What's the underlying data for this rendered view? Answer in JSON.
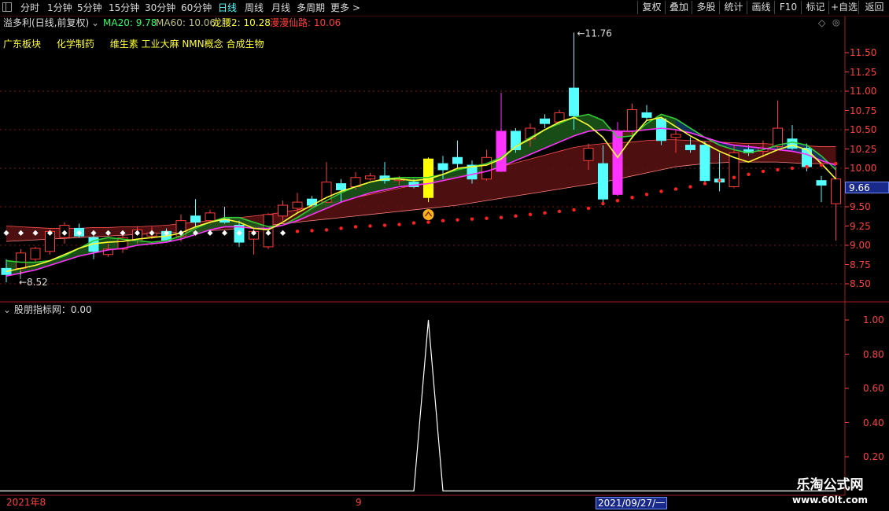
{
  "toolbar": {
    "periods": [
      "分时",
      "1分钟",
      "5分钟",
      "15分钟",
      "30分钟",
      "60分钟",
      "日线",
      "周线",
      "月线",
      "多周期",
      "更多 >"
    ],
    "active_period": "日线",
    "right_buttons": [
      "复权",
      "叠加",
      "多股",
      "统计",
      "画线",
      "F10",
      "标记",
      "+自选",
      "返回"
    ]
  },
  "info_bar": {
    "stock_name": "溢多利(日线,前复权)",
    "ma20": "MA20: 9.78",
    "ma60": "MA60: 10.06",
    "longyao": "龙腰2: 10.28",
    "xianlu": "漫漫仙路: 10.06"
  },
  "concepts": [
    "广东板块",
    "化学制药",
    "维生素 工业大麻 NMN概念 合成生物"
  ],
  "price_axis": {
    "ticks": [
      "11.50",
      "11.25",
      "11.00",
      "10.75",
      "10.50",
      "10.25",
      "10.00",
      "9.75",
      "9.50",
      "9.25",
      "9.00",
      "8.75",
      "8.50"
    ],
    "current_price": "9.66",
    "high_label": "11.76",
    "low_label": "8.52"
  },
  "indicator": {
    "title": "股朋指标网：0.00",
    "ticks": [
      "1.00",
      "0.80",
      "0.60",
      "0.40",
      "0.20"
    ]
  },
  "date_bar": {
    "left": "2021年8",
    "mid": "9",
    "selected": "2021/09/27/一"
  },
  "watermark": {
    "title": "乐淘公式网",
    "url": "www.60lt.com"
  },
  "colors": {
    "up": "#ff3b3b",
    "down": "#55ffff",
    "ma_yellow": "#ffff33",
    "ma_magenta": "#ff33ff",
    "ma_green": "#33cc33",
    "axis": "#ff4040"
  },
  "chart_data": {
    "type": "candlestick",
    "dates_shown": [
      "2021年8",
      "9",
      "2021/09/27/一"
    ],
    "ohlc": [
      {
        "o": 8.7,
        "h": 8.82,
        "l": 8.52,
        "c": 8.62,
        "type": "down"
      },
      {
        "o": 8.7,
        "h": 8.95,
        "l": 8.62,
        "c": 8.9,
        "type": "up"
      },
      {
        "o": 8.82,
        "h": 8.98,
        "l": 8.78,
        "c": 8.96,
        "type": "up"
      },
      {
        "o": 8.92,
        "h": 9.2,
        "l": 8.88,
        "c": 9.18,
        "type": "up"
      },
      {
        "o": 9.1,
        "h": 9.3,
        "l": 9.02,
        "c": 9.26,
        "type": "up"
      },
      {
        "o": 9.22,
        "h": 9.28,
        "l": 9.1,
        "c": 9.12,
        "type": "down"
      },
      {
        "o": 9.1,
        "h": 9.18,
        "l": 8.82,
        "c": 8.92,
        "type": "down"
      },
      {
        "o": 8.88,
        "h": 9.02,
        "l": 8.85,
        "c": 8.95,
        "type": "up"
      },
      {
        "o": 8.95,
        "h": 9.16,
        "l": 8.9,
        "c": 9.1,
        "type": "up"
      },
      {
        "o": 9.06,
        "h": 9.25,
        "l": 9.02,
        "c": 9.2,
        "type": "up"
      },
      {
        "o": 9.12,
        "h": 9.24,
        "l": 9.08,
        "c": 9.16,
        "type": "up"
      },
      {
        "o": 9.18,
        "h": 9.22,
        "l": 9.04,
        "c": 9.06,
        "type": "down"
      },
      {
        "o": 9.12,
        "h": 9.4,
        "l": 9.05,
        "c": 9.32,
        "type": "up"
      },
      {
        "o": 9.3,
        "h": 9.6,
        "l": 9.24,
        "c": 9.38,
        "type": "down"
      },
      {
        "o": 9.32,
        "h": 9.46,
        "l": 9.28,
        "c": 9.42,
        "type": "up"
      },
      {
        "o": 9.34,
        "h": 9.5,
        "l": 9.28,
        "c": 9.3,
        "type": "down"
      },
      {
        "o": 9.26,
        "h": 9.32,
        "l": 8.98,
        "c": 9.04,
        "type": "down"
      },
      {
        "o": 9.08,
        "h": 9.22,
        "l": 8.88,
        "c": 9.18,
        "type": "up"
      },
      {
        "o": 8.98,
        "h": 9.42,
        "l": 8.95,
        "c": 9.4,
        "type": "up"
      },
      {
        "o": 9.38,
        "h": 9.58,
        "l": 9.32,
        "c": 9.52,
        "type": "up"
      },
      {
        "o": 9.48,
        "h": 9.68,
        "l": 9.42,
        "c": 9.56,
        "type": "up"
      },
      {
        "o": 9.6,
        "h": 9.64,
        "l": 9.5,
        "c": 9.52,
        "type": "down"
      },
      {
        "o": 9.56,
        "h": 10.08,
        "l": 9.55,
        "c": 9.82,
        "type": "up"
      },
      {
        "o": 9.8,
        "h": 9.86,
        "l": 9.56,
        "c": 9.72,
        "type": "down"
      },
      {
        "o": 9.76,
        "h": 9.95,
        "l": 9.72,
        "c": 9.88,
        "type": "up"
      },
      {
        "o": 9.86,
        "h": 9.94,
        "l": 9.84,
        "c": 9.9,
        "type": "up"
      },
      {
        "o": 9.9,
        "h": 10.08,
        "l": 9.8,
        "c": 9.84,
        "type": "down"
      },
      {
        "o": 9.84,
        "h": 9.9,
        "l": 9.78,
        "c": 9.86,
        "type": "up"
      },
      {
        "o": 9.82,
        "h": 9.86,
        "l": 9.74,
        "c": 9.76,
        "type": "down"
      },
      {
        "o": 9.62,
        "h": 10.14,
        "l": 9.56,
        "c": 10.12,
        "type": "up",
        "hl": "yellow"
      },
      {
        "o": 9.98,
        "h": 10.16,
        "l": 9.86,
        "c": 10.06,
        "type": "down"
      },
      {
        "o": 10.06,
        "h": 10.36,
        "l": 10.0,
        "c": 10.14,
        "type": "down"
      },
      {
        "o": 10.04,
        "h": 10.1,
        "l": 9.8,
        "c": 9.86,
        "type": "down"
      },
      {
        "o": 9.86,
        "h": 10.24,
        "l": 9.84,
        "c": 10.14,
        "type": "up"
      },
      {
        "o": 9.96,
        "h": 10.98,
        "l": 9.95,
        "c": 10.48,
        "type": "up",
        "hl": "magenta"
      },
      {
        "o": 10.48,
        "h": 10.52,
        "l": 10.2,
        "c": 10.24,
        "type": "down"
      },
      {
        "o": 10.38,
        "h": 10.58,
        "l": 10.28,
        "c": 10.52,
        "type": "up"
      },
      {
        "o": 10.58,
        "h": 10.7,
        "l": 10.52,
        "c": 10.64,
        "type": "down"
      },
      {
        "o": 10.6,
        "h": 10.76,
        "l": 10.56,
        "c": 10.72,
        "type": "up"
      },
      {
        "o": 10.68,
        "h": 11.76,
        "l": 10.5,
        "c": 11.04,
        "type": "down"
      },
      {
        "o": 10.1,
        "h": 10.32,
        "l": 9.98,
        "c": 10.26,
        "type": "up"
      },
      {
        "o": 10.06,
        "h": 10.3,
        "l": 9.56,
        "c": 9.6,
        "type": "down"
      },
      {
        "o": 9.66,
        "h": 10.6,
        "l": 9.64,
        "c": 10.48,
        "type": "up",
        "hl": "magenta"
      },
      {
        "o": 10.48,
        "h": 10.84,
        "l": 10.38,
        "c": 10.76,
        "type": "up"
      },
      {
        "o": 10.72,
        "h": 10.82,
        "l": 10.62,
        "c": 10.66,
        "type": "down"
      },
      {
        "o": 10.64,
        "h": 10.66,
        "l": 10.3,
        "c": 10.36,
        "type": "down"
      },
      {
        "o": 10.4,
        "h": 10.5,
        "l": 10.2,
        "c": 10.44,
        "type": "up"
      },
      {
        "o": 10.3,
        "h": 10.4,
        "l": 10.2,
        "c": 10.24,
        "type": "down"
      },
      {
        "o": 10.3,
        "h": 10.35,
        "l": 9.8,
        "c": 9.84,
        "type": "down"
      },
      {
        "o": 9.86,
        "h": 10.2,
        "l": 9.7,
        "c": 9.82,
        "type": "down"
      },
      {
        "o": 9.76,
        "h": 10.3,
        "l": 9.74,
        "c": 10.2,
        "type": "up"
      },
      {
        "o": 10.24,
        "h": 10.3,
        "l": 10.16,
        "c": 10.2,
        "type": "down"
      },
      {
        "o": 10.22,
        "h": 10.36,
        "l": 10.14,
        "c": 10.26,
        "type": "up"
      },
      {
        "o": 10.28,
        "h": 10.88,
        "l": 10.26,
        "c": 10.52,
        "type": "up"
      },
      {
        "o": 10.38,
        "h": 10.56,
        "l": 10.24,
        "c": 10.26,
        "type": "down"
      },
      {
        "o": 10.26,
        "h": 10.32,
        "l": 9.96,
        "c": 10.02,
        "type": "down"
      },
      {
        "o": 9.84,
        "h": 9.9,
        "l": 9.56,
        "c": 9.78,
        "type": "down"
      },
      {
        "o": 9.54,
        "h": 10.02,
        "l": 9.06,
        "c": 9.86,
        "type": "up"
      }
    ],
    "ma_yellow": [
      8.66,
      8.7,
      8.74,
      8.8,
      8.88,
      8.96,
      9.02,
      9.04,
      9.05,
      9.08,
      9.1,
      9.12,
      9.16,
      9.24,
      9.3,
      9.34,
      9.3,
      9.22,
      9.2,
      9.3,
      9.42,
      9.52,
      9.62,
      9.7,
      9.76,
      9.82,
      9.86,
      9.86,
      9.84,
      9.86,
      9.92,
      10.0,
      10.02,
      10.04,
      10.12,
      10.28,
      10.38,
      10.5,
      10.6,
      10.66,
      10.56,
      10.4,
      10.14,
      10.4,
      10.62,
      10.66,
      10.54,
      10.42,
      10.32,
      10.22,
      10.14,
      10.08,
      10.16,
      10.24,
      10.3,
      10.24,
      10.06,
      9.86
    ],
    "ma_magenta": [
      8.6,
      8.64,
      8.68,
      8.74,
      8.8,
      8.86,
      8.9,
      8.94,
      8.96,
      9.0,
      9.02,
      9.04,
      9.08,
      9.14,
      9.2,
      9.24,
      9.24,
      9.22,
      9.22,
      9.26,
      9.32,
      9.4,
      9.48,
      9.56,
      9.62,
      9.68,
      9.72,
      9.76,
      9.78,
      9.8,
      9.84,
      9.88,
      9.92,
      9.96,
      10.02,
      10.1,
      10.18,
      10.26,
      10.34,
      10.42,
      10.48,
      10.5,
      10.48,
      10.48,
      10.5,
      10.52,
      10.5,
      10.46,
      10.4,
      10.34,
      10.3,
      10.28,
      10.26,
      10.24,
      10.22,
      10.18,
      10.1,
      10.04
    ],
    "ma_green": [
      8.8,
      8.78,
      8.78,
      8.8,
      8.86,
      8.96,
      9.06,
      9.1,
      9.08,
      9.06,
      9.04,
      9.06,
      9.12,
      9.22,
      9.3,
      9.36,
      9.36,
      9.3,
      9.24,
      9.26,
      9.36,
      9.48,
      9.58,
      9.68,
      9.76,
      9.82,
      9.86,
      9.88,
      9.88,
      9.88,
      9.92,
      9.98,
      10.02,
      10.06,
      10.14,
      10.28,
      10.4,
      10.5,
      10.58,
      10.66,
      10.7,
      10.62,
      10.4,
      10.42,
      10.58,
      10.7,
      10.64,
      10.52,
      10.4,
      10.3,
      10.24,
      10.2,
      10.24,
      10.3,
      10.34,
      10.3,
      10.16,
      9.98
    ],
    "band_upper": [
      9.25,
      9.24,
      9.23,
      9.22,
      9.22,
      9.22,
      9.23,
      9.23,
      9.24,
      9.24,
      9.25,
      9.26,
      9.28,
      9.3,
      9.32,
      9.34,
      9.36,
      9.38,
      9.4,
      9.43,
      9.46,
      9.5,
      9.54,
      9.58,
      9.62,
      9.66,
      9.7,
      9.74,
      9.78,
      9.82,
      9.86,
      9.9,
      9.94,
      9.98,
      10.02,
      10.07,
      10.12,
      10.17,
      10.22,
      10.27,
      10.3,
      10.32,
      10.33,
      10.34,
      10.36,
      10.37,
      10.37,
      10.36,
      10.35,
      10.34,
      10.33,
      10.32,
      10.32,
      10.31,
      10.3,
      10.29,
      10.28,
      10.28
    ],
    "band_lower": [
      9.05,
      9.06,
      9.07,
      9.08,
      9.09,
      9.1,
      9.11,
      9.12,
      9.13,
      9.14,
      9.15,
      9.16,
      9.17,
      9.18,
      9.19,
      9.2,
      9.22,
      9.24,
      9.26,
      9.28,
      9.3,
      9.32,
      9.34,
      9.36,
      9.38,
      9.4,
      9.42,
      9.44,
      9.46,
      9.48,
      9.5,
      9.52,
      9.55,
      9.58,
      9.61,
      9.64,
      9.67,
      9.7,
      9.73,
      9.76,
      9.79,
      9.82,
      9.86,
      9.9,
      9.94,
      9.98,
      10.02,
      10.04,
      10.06,
      10.07,
      10.08,
      10.08,
      10.08,
      10.08,
      10.07,
      10.06,
      10.06,
      10.06
    ],
    "dots": [
      9.16,
      9.16,
      9.16,
      9.16,
      9.16,
      9.16,
      9.16,
      9.16,
      9.16,
      9.16,
      9.16,
      9.16,
      9.16,
      9.16,
      9.16,
      9.16,
      9.16,
      9.16,
      9.16,
      9.16,
      9.18,
      9.19,
      9.2,
      9.22,
      9.24,
      9.25,
      9.26,
      9.27,
      9.29,
      9.3,
      9.32,
      9.33,
      9.34,
      9.35,
      9.36,
      9.38,
      9.4,
      9.42,
      9.44,
      9.46,
      9.48,
      9.54,
      9.58,
      9.62,
      9.66,
      9.7,
      9.73,
      9.76,
      9.8,
      9.84,
      9.88,
      9.92,
      9.96,
      9.98,
      10.0,
      10.02,
      10.04,
      10.06
    ],
    "dots_white_until": 20,
    "signal_index": 29,
    "indicator_values": [
      0,
      0,
      0,
      0,
      0,
      0,
      0,
      0,
      0,
      0,
      0,
      0,
      0,
      0,
      0,
      0,
      0,
      0,
      0,
      0,
      0,
      0,
      0,
      0,
      0,
      0,
      0,
      0,
      0,
      1,
      0,
      0,
      0,
      0,
      0,
      0,
      0,
      0,
      0,
      0,
      0,
      0,
      0,
      0,
      0,
      0,
      0,
      0,
      0,
      0,
      0,
      0,
      0,
      0,
      0,
      0,
      0,
      0
    ],
    "price_range": [
      8.3,
      11.8
    ],
    "indicator_range": [
      0,
      1.0
    ]
  }
}
